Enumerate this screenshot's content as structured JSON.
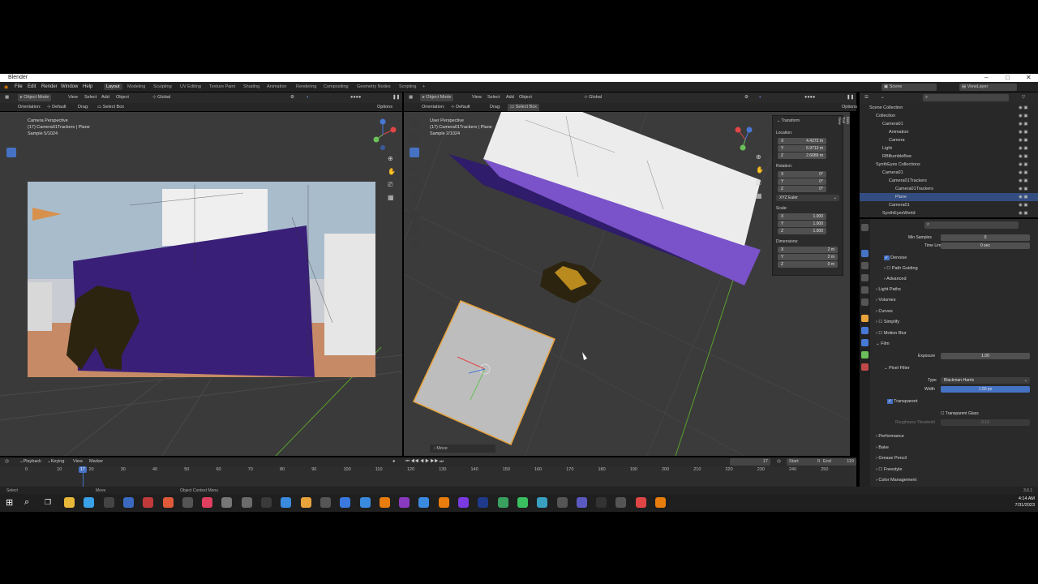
{
  "window": {
    "title": "Blender",
    "controls": [
      "–",
      "□",
      "✕"
    ]
  },
  "menu": [
    "File",
    "Edit",
    "Render",
    "Window",
    "Help"
  ],
  "workspaces": [
    {
      "label": "Layout",
      "active": true
    },
    {
      "label": "Modeling"
    },
    {
      "label": "Sculpting"
    },
    {
      "label": "UV Editing"
    },
    {
      "label": "Texture Paint"
    },
    {
      "label": "Shading"
    },
    {
      "label": "Animation"
    },
    {
      "label": "Rendering"
    },
    {
      "label": "Compositing"
    },
    {
      "label": "Geometry Nodes"
    },
    {
      "label": "Scripting"
    },
    {
      "label": "+"
    }
  ],
  "scene": {
    "scene_name": "Scene",
    "view_layer": "ViewLayer"
  },
  "left_viewport": {
    "mode": "Object Mode",
    "menus": [
      "View",
      "Select",
      "Add",
      "Object"
    ],
    "transform_orientation": "Global",
    "orientation_label": "Orientation:",
    "orientation_value": "Default",
    "drag_label": "Drag:",
    "drag_value": "Select Box",
    "options": "Options",
    "overlay_lines": [
      "Camera Perspective",
      "(17) Camera01Trackers | Plane",
      "Sample 5/1024"
    ]
  },
  "right_viewport": {
    "mode": "Object Mode",
    "menus": [
      "View",
      "Select",
      "Add",
      "Object"
    ],
    "transform_orientation": "Global",
    "orientation_label": "Orientation:",
    "orientation_value": "Default",
    "drag_label": "Drag:",
    "drag_value": "Select Box",
    "options": "Options",
    "overlay_lines": [
      "User Perspective",
      "(17) Camera01Trackers | Plane",
      "Sample 2/1024"
    ],
    "operator_panel": "Move",
    "sidebar_tabs": [
      "Item",
      "Tool",
      "View"
    ]
  },
  "transform_panel": {
    "title": "Transform",
    "location_label": "Location:",
    "location": [
      {
        "axis": "X",
        "value": "4.4272 m"
      },
      {
        "axis": "Y",
        "value": "5.9713 m"
      },
      {
        "axis": "Z",
        "value": "2.6689 m"
      }
    ],
    "rotation_label": "Rotation:",
    "rotation": [
      {
        "axis": "X",
        "value": "0°"
      },
      {
        "axis": "Y",
        "value": "0°"
      },
      {
        "axis": "Z",
        "value": "0°"
      }
    ],
    "rotation_mode": "XYZ Euler",
    "scale_label": "Scale:",
    "scale": [
      {
        "axis": "X",
        "value": "1.000"
      },
      {
        "axis": "Y",
        "value": "1.000"
      },
      {
        "axis": "Z",
        "value": "1.000"
      }
    ],
    "dimensions_label": "Dimensions:",
    "dimensions": [
      {
        "axis": "X",
        "value": "2 m"
      },
      {
        "axis": "Y",
        "value": "2 m"
      },
      {
        "axis": "Z",
        "value": "0 m"
      }
    ]
  },
  "outliner": [
    {
      "label": "Scene Collection",
      "indent": 0
    },
    {
      "label": "Collection",
      "indent": 1
    },
    {
      "label": "Camera01",
      "indent": 2
    },
    {
      "label": "Animation",
      "indent": 3
    },
    {
      "label": "Camera",
      "indent": 3
    },
    {
      "label": "Light",
      "indent": 2
    },
    {
      "label": "RBBumbleBee",
      "indent": 2
    },
    {
      "label": "SynthEyes Collections",
      "indent": 1
    },
    {
      "label": "Camera01",
      "indent": 2
    },
    {
      "label": "Camera01Trackers",
      "indent": 3
    },
    {
      "label": "Camera01Trackers",
      "indent": 4
    },
    {
      "label": "Plane",
      "indent": 4,
      "selected": true
    },
    {
      "label": "Camera01",
      "indent": 3
    },
    {
      "label": "SynthEyesWorld",
      "indent": 2
    }
  ],
  "properties": {
    "min_samples_label": "Min Samples",
    "min_samples": "0",
    "time_limit_label": "Time Limit",
    "time_limit": "0 sec",
    "denoise": "Denoise",
    "path_guiding": "Path Guiding",
    "advanced": "Advanced",
    "light_paths": "Light Paths",
    "volumes": "Volumes",
    "curves": "Curves",
    "simplify": "Simplify",
    "motion_blur": "Motion Blur",
    "film": "Film",
    "exposure_label": "Exposure",
    "exposure": "1.00",
    "pixel_filter": "Pixel Filter",
    "type_label": "Type",
    "type_value": "Blackman-Harris",
    "width_label": "Width",
    "width_value": "1.50 px",
    "transparent": "Transparent",
    "transparent_glass": "Transparent Glass",
    "roughness_label": "Roughness Threshold",
    "roughness_value": "0.10",
    "performance": "Performance",
    "bake": "Bake",
    "grease_pencil": "Grease Pencil",
    "freestyle": "Freestyle",
    "color_management": "Color Management"
  },
  "timeline": {
    "menus": [
      "Playback",
      "Keying",
      "View",
      "Marker"
    ],
    "current_frame": "17",
    "start_label": "Start",
    "start": "0",
    "end_label": "End",
    "end": "119",
    "ticks": [
      "0",
      "10",
      "20",
      "30",
      "40",
      "50",
      "60",
      "70",
      "80",
      "90",
      "100",
      "110",
      "120",
      "130",
      "140",
      "150",
      "160",
      "170",
      "180",
      "190",
      "200",
      "210",
      "220",
      "230",
      "240",
      "250"
    ],
    "playhead": "17"
  },
  "status_bar": {
    "left": "Select",
    "middle": "Move",
    "right": "Object Context Menu",
    "version": "3.6.1"
  },
  "taskbar": {
    "time": "4:14 AM",
    "date": "7/31/2023"
  },
  "colors": {
    "accent": "#4672c4",
    "selection": "#334d80",
    "purple_wall": "#3a1f78",
    "plane_outline": "#e8a33b"
  }
}
